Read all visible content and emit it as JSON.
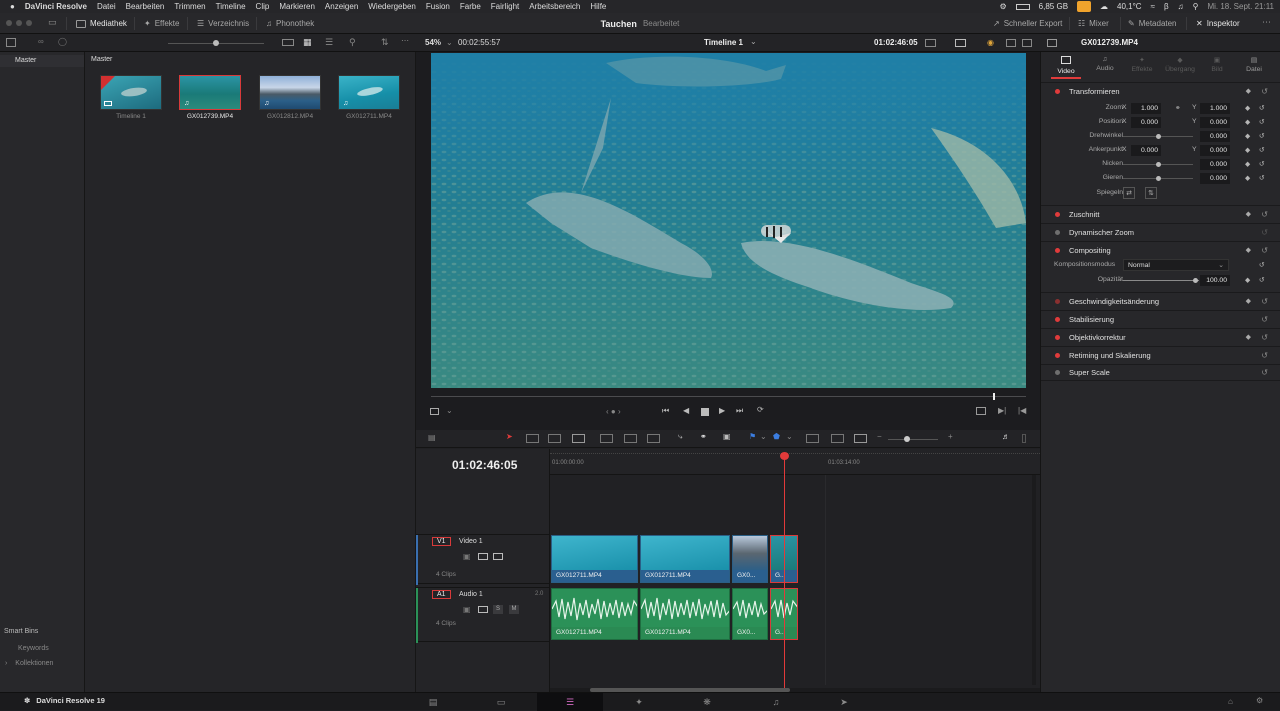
{
  "menubar": {
    "apple": "",
    "app": "DaVinci Resolve",
    "items": [
      "Datei",
      "Bearbeiten",
      "Trimmen",
      "Timeline",
      "Clip",
      "Markieren",
      "Anzeigen",
      "Wiedergeben",
      "Fusion",
      "Farbe",
      "Fairlight",
      "Arbeitsbereich",
      "Hilfe"
    ],
    "storage": "6,85 GB",
    "temperature": "40,1°C",
    "datetime": "Mi. 18. Sept.  21:11"
  },
  "toolbar": {
    "mediathek": "Mediathek",
    "effekte": "Effekte",
    "verzeichnis": "Verzeichnis",
    "phonothek": "Phonothek",
    "project_title": "Tauchen",
    "project_status": "Bearbeitet",
    "schneller_export": "Schneller Export",
    "mixer": "Mixer",
    "metadaten": "Metadaten",
    "inspektor": "Inspektor"
  },
  "subbar": {
    "zoom": "54%",
    "duration": "00:02:55:57",
    "timeline_name": "Timeline 1",
    "timecode": "01:02:46:05",
    "clip_name": "GX012739.MP4"
  },
  "left_panel": {
    "master": "Master",
    "smart_bins": "Smart Bins",
    "keywords": "Keywords",
    "kollektionen": "Kollektionen"
  },
  "bin": {
    "title": "Master",
    "clips": [
      {
        "name": "Timeline 1",
        "selected": false
      },
      {
        "name": "GX012739.MP4",
        "selected": true
      },
      {
        "name": "GX012812.MP4",
        "selected": false
      },
      {
        "name": "GX012711.MP4",
        "selected": false
      }
    ]
  },
  "inspector": {
    "tabs": [
      "Video",
      "Audio",
      "Effekte",
      "Übergang",
      "Bild",
      "Datei"
    ],
    "active_tab": "Video",
    "transform": {
      "title": "Transformieren",
      "zoom_label": "Zoom",
      "zoom_x": "1.000",
      "zoom_y": "1.000",
      "position_label": "Position",
      "pos_x": "0.000",
      "pos_y": "0.000",
      "rotation_label": "Drehwinkel",
      "rotation": "0.000",
      "anchor_label": "Ankerpunkt",
      "anchor_x": "0.000",
      "anchor_y": "0.000",
      "pitch_label": "Nicken",
      "pitch": "0.000",
      "yaw_label": "Gieren",
      "yaw": "0.000",
      "flip_label": "Spiegeln",
      "x": "X",
      "y": "Y"
    },
    "sections": {
      "zuschnitt": "Zuschnitt",
      "dyn_zoom": "Dynamischer Zoom",
      "compositing": "Compositing",
      "komp_modus_label": "Kompositionsmodus",
      "komp_modus": "Normal",
      "opacity_label": "Opazität",
      "opacity": "100.00",
      "speed": "Geschwindigkeitsänderung",
      "stabilisierung": "Stabilisierung",
      "objektiv": "Objektivkorrektur",
      "retiming": "Retiming und Skalierung",
      "superscale": "Super Scale"
    }
  },
  "timeline": {
    "timecode": "01:02:46:05",
    "ruler_start": "01:00:00:00",
    "ruler_mark": "01:03:14:00",
    "video_track": {
      "id": "V1",
      "name": "Video 1",
      "count": "4 Clips"
    },
    "audio_track": {
      "id": "A1",
      "name": "Audio 1",
      "channels": "2.0",
      "count": "4 Clips",
      "solo": "S",
      "mute": "M"
    },
    "video_clips": [
      "GX012711.MP4",
      "GX012711.MP4",
      "GX0...",
      "G..."
    ],
    "audio_clips": [
      "GX012711.MP4",
      "GX012711.MP4",
      "GX0...",
      "G..."
    ]
  },
  "footer": {
    "app": "DaVinci Resolve 19"
  },
  "colors": {
    "accent_red": "#e03b3b",
    "video_clip": "#2f6a98",
    "audio_clip": "#2b9158",
    "playhead": "#e23a3a"
  }
}
